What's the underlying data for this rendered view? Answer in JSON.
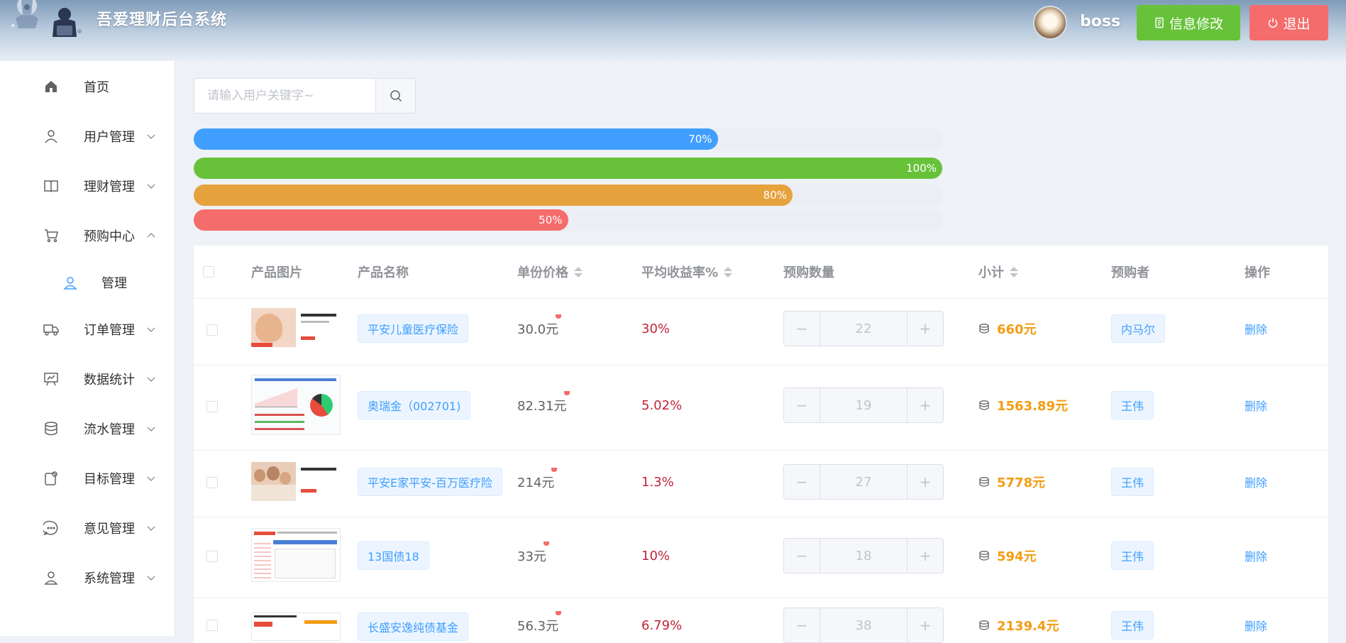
{
  "header": {
    "title": "吾爱理财后台系统",
    "username": "boss",
    "edit_label": "信息修改",
    "logout_label": "退出",
    "colors": {
      "edit": "#67c23a",
      "logout": "#f56c6c"
    }
  },
  "sidebar": {
    "items": [
      {
        "label": "首页",
        "icon": "home-icon",
        "chevron": false
      },
      {
        "label": "用户管理",
        "icon": "user-icon",
        "chevron": "down"
      },
      {
        "label": "理财管理",
        "icon": "book-icon",
        "chevron": "down"
      },
      {
        "label": "预购中心",
        "icon": "cart-icon",
        "chevron": "up"
      },
      {
        "label": "管理",
        "icon": "user-circle-icon",
        "chevron": false,
        "sub": true,
        "active": true
      },
      {
        "label": "订单管理",
        "icon": "truck-icon",
        "chevron": "down"
      },
      {
        "label": "数据统计",
        "icon": "board-icon",
        "chevron": "down"
      },
      {
        "label": "流水管理",
        "icon": "coin-icon",
        "chevron": "down"
      },
      {
        "label": "目标管理",
        "icon": "target-icon",
        "chevron": "down"
      },
      {
        "label": "意见管理",
        "icon": "chat-icon",
        "chevron": "down"
      },
      {
        "label": "系统管理",
        "icon": "settings-user-icon",
        "chevron": "down"
      }
    ]
  },
  "search": {
    "placeholder": "请输入用户关键字~",
    "value": ""
  },
  "progress": [
    {
      "percent": 70,
      "label": "70%",
      "color": "#409eff"
    },
    {
      "percent": 100,
      "label": "100%",
      "color": "#67c23a"
    },
    {
      "percent": 80,
      "label": "80%",
      "color": "#e6a23c"
    },
    {
      "percent": 50,
      "label": "50%",
      "color": "#f56c6c"
    }
  ],
  "table": {
    "headers": {
      "image": "产品图片",
      "name": "产品名称",
      "price": "单份价格",
      "rate": "平均收益率%",
      "qty": "预购数量",
      "subtotal": "小计",
      "buyer": "预购者",
      "action": "操作"
    },
    "rows": [
      {
        "name": "平安儿童医疗保险",
        "price": "30.0元",
        "rate": "30%",
        "qty": "22",
        "subtotal": "660元",
        "buyer": "内马尔",
        "action": "删除",
        "thumb": "kid"
      },
      {
        "name": "奥瑞金（002701)",
        "price": "82.31元",
        "rate": "5.02%",
        "qty": "19",
        "subtotal": "1563.89元",
        "buyer": "王伟",
        "action": "删除",
        "thumb": "chart"
      },
      {
        "name": "平安E家平安-百万医疗险",
        "price": "214元",
        "rate": "1.3%",
        "qty": "27",
        "subtotal": "5778元",
        "buyer": "王伟",
        "action": "删除",
        "thumb": "family"
      },
      {
        "name": "13国债18",
        "price": "33元",
        "rate": "10%",
        "qty": "18",
        "subtotal": "594元",
        "buyer": "王伟",
        "action": "删除",
        "thumb": "grid"
      },
      {
        "name": "长盛安逸纯债基金",
        "price": "56.3元",
        "rate": "6.79%",
        "qty": "38",
        "subtotal": "2139.4元",
        "buyer": "王伟",
        "action": "删除",
        "thumb": "fund"
      }
    ]
  }
}
